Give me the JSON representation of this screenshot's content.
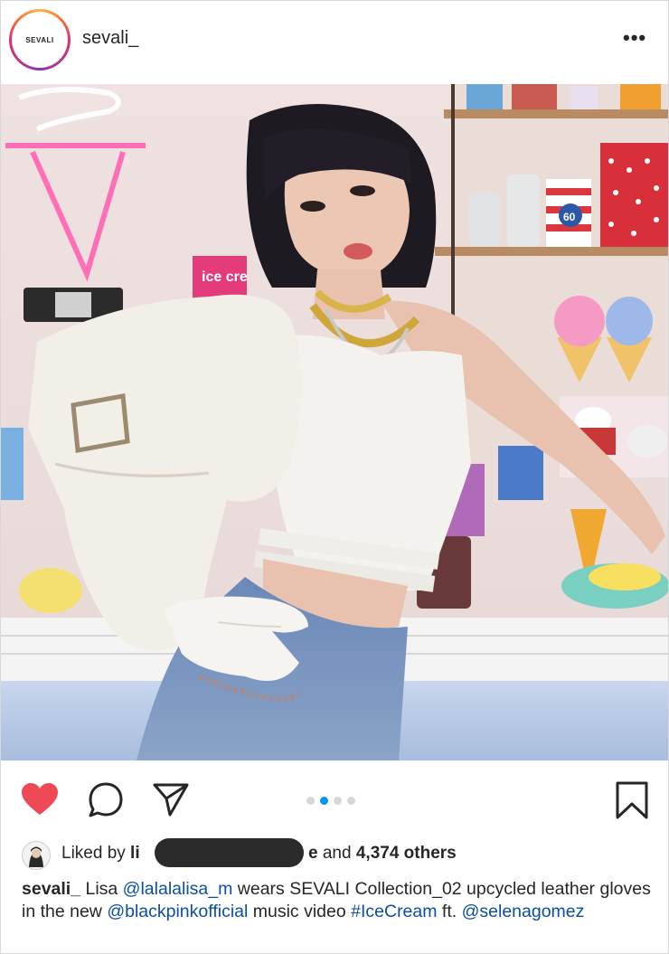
{
  "header": {
    "avatar_logo_text": "SEVALI",
    "username": "sevali_",
    "more_icon": "ellipsis-icon"
  },
  "photo": {
    "sign_text": "ice cre",
    "cup_text": "60"
  },
  "actions": {
    "like_icon": "heart-filled-icon",
    "comment_icon": "comment-icon",
    "share_icon": "paper-plane-icon",
    "save_icon": "bookmark-icon",
    "like_color": "#ed4956",
    "carousel_total": 4,
    "carousel_active": 2
  },
  "likes": {
    "prefix": "Liked by ",
    "name_start": "li",
    "name_end": "e",
    "suffix_and": " and ",
    "others": "4,374 others"
  },
  "caption": {
    "username": "sevali_",
    "text1": " Lisa ",
    "mention1": "@lalalalisa_m",
    "text2": " wears SEVALI Collection_02 upcycled leather gloves in the new ",
    "mention2": "@blackpinkofficial",
    "text3": " music video ",
    "hashtag": "#IceCream",
    "text4": " ft. ",
    "mention3": "@selenagomez"
  }
}
